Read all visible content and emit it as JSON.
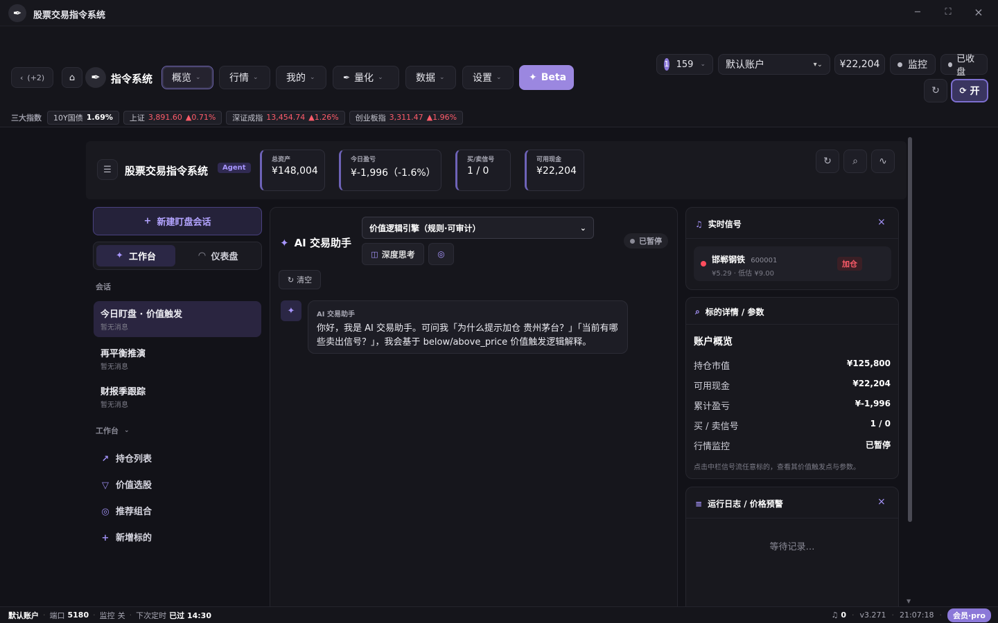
{
  "window": {
    "title": "股票交易指令系统",
    "min": "−",
    "max": "⛶",
    "close": "×"
  },
  "nav": {
    "back": "(+2)",
    "brand": "指令系统",
    "items": [
      "概览",
      "行情",
      "我的",
      "量化",
      "数据",
      "设置"
    ],
    "beta": "Beta"
  },
  "header_right": {
    "badge_num": "1",
    "badge_count": "159",
    "account": "默认账户",
    "cash": "¥22,204",
    "monitor": "监控",
    "closed": "已收盘",
    "toggle": "开"
  },
  "ticker": {
    "label": "三大指数",
    "items": [
      {
        "name": "10Y国债",
        "value": "1.69%",
        "change": ""
      },
      {
        "name": "上证",
        "value": "3,891.60",
        "change": "▲0.71%"
      },
      {
        "name": "深证成指",
        "value": "13,454.74",
        "change": "▲1.26%"
      },
      {
        "name": "创业板指",
        "value": "3,311.47",
        "change": "▲1.96%"
      }
    ]
  },
  "dashboard": {
    "title": "股票交易指令系统",
    "tag": "Agent",
    "stats": [
      {
        "label": "总资产",
        "value": "¥148,004"
      },
      {
        "label": "今日盈亏",
        "value": "¥-1,996（-1.6%）"
      },
      {
        "label": "买/卖信号",
        "value": "1 / 0"
      },
      {
        "label": "可用现金",
        "value": "¥22,204"
      }
    ]
  },
  "sidebar": {
    "new_session": "新建盯盘会话",
    "tab_workbench": "工作台",
    "tab_dashboard": "仪表盘",
    "section_sessions": "会话",
    "sessions": [
      {
        "title": "今日盯盘 · 价值触发",
        "sub": "暂无消息"
      },
      {
        "title": "再平衡推演",
        "sub": "暂无消息"
      },
      {
        "title": "财报季跟踪",
        "sub": "暂无消息"
      }
    ],
    "section_workbench": "工作台",
    "workbench_items": [
      "持仓列表",
      "价值选股",
      "推荐组合",
      "新增标的"
    ]
  },
  "chat": {
    "title": "AI 交易助手",
    "engine": "价值逻辑引擎（规则·可审计）",
    "deep_think": "深度思考",
    "paused": "已暂停",
    "clear": "清空",
    "msg_sender": "AI 交易助手",
    "msg_text": "你好，我是 AI 交易助手。可问我「为什么提示加仓 贵州茅台？」「当前有哪些卖出信号？」，我会基于 below/above_price 价值触发逻辑解释。"
  },
  "signals": {
    "title": "实时信号",
    "name": "邯郸钢铁",
    "code": "600001",
    "detail": "¥5.29 · 低估 ¥9.00",
    "action": "加仓"
  },
  "detail": {
    "title": "标的详情 / 参数",
    "heading": "账户概览",
    "rows": [
      {
        "k": "持仓市值",
        "v": "¥125,800"
      },
      {
        "k": "可用现金",
        "v": "¥22,204"
      },
      {
        "k": "累计盈亏",
        "v": "¥-1,996"
      },
      {
        "k": "买 / 卖信号",
        "v": "1 / 0"
      },
      {
        "k": "行情监控",
        "v": "已暂停"
      }
    ],
    "hint": "点击中栏信号流任意标的，查看其价值触发点与参数。"
  },
  "log": {
    "title": "运行日志 / 价格预警",
    "empty": "等待记录…"
  },
  "status": {
    "account": "默认账户",
    "port_label": "端口",
    "port": "5180",
    "monitor_label": "监控",
    "monitor": "关",
    "timer_label": "下次定时",
    "timer": "已过 14:30",
    "alerts": "0",
    "version": "v3.271",
    "time": "21:07:18",
    "member": "会员·pro"
  },
  "colors": {
    "accent": "#9b87e0",
    "up": "#ff5c6a",
    "down": "#3ddc84",
    "bg": "#121218"
  }
}
